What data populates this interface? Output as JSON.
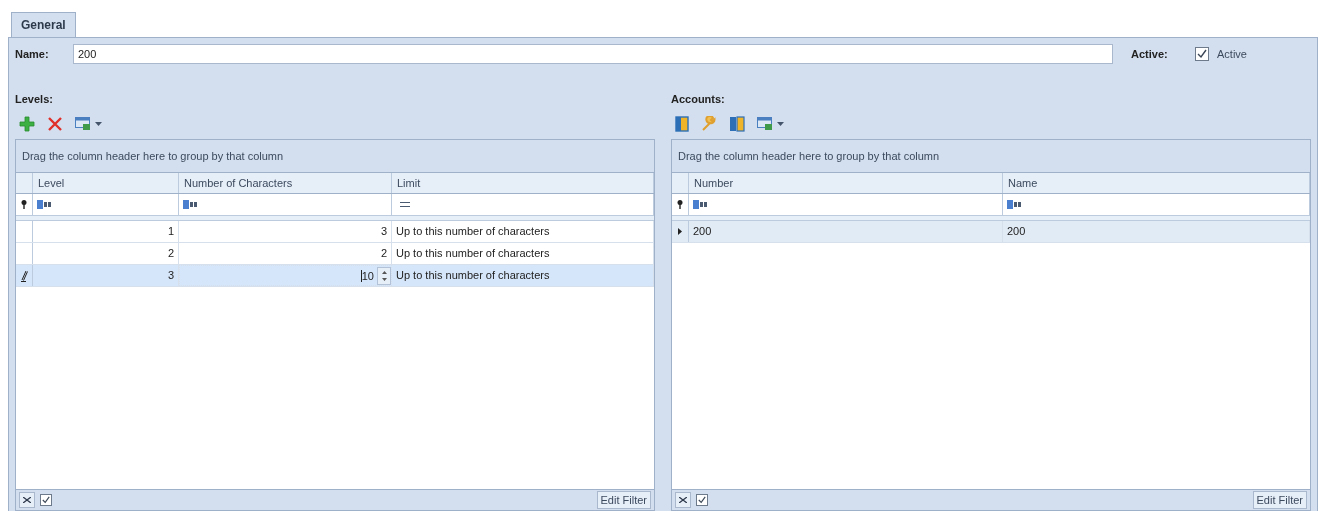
{
  "tabs": [
    {
      "label": "General",
      "selected": true
    }
  ],
  "name_field": {
    "label": "Name:",
    "value": "200"
  },
  "active": {
    "label": "Active:",
    "checkbox_label": "Active",
    "checked": true
  },
  "levels": {
    "title": "Levels:",
    "toolbar": [
      {
        "kind": "add"
      },
      {
        "kind": "delete"
      },
      {
        "kind": "export"
      }
    ],
    "grid": {
      "group_panel": "Drag the column header here to group by that column",
      "columns": [
        "Level",
        "Number of Characters",
        "Limit"
      ],
      "filters": [
        {
          "kind": "text"
        },
        {
          "kind": "text"
        },
        {
          "kind": "equals"
        }
      ],
      "rows": [
        {
          "level": "1",
          "characters": "3",
          "limit": "Up to this number of characters",
          "selected": false,
          "editing": false
        },
        {
          "level": "2",
          "characters": "2",
          "limit": "Up to this number of characters",
          "selected": false,
          "editing": false
        },
        {
          "level": "3",
          "characters": "10",
          "limit": "Up to this number of characters",
          "selected": true,
          "editing": true
        }
      ],
      "footer": {
        "filter_enabled": true,
        "edit_filter": "Edit Filter"
      }
    }
  },
  "accounts": {
    "title": "Accounts:",
    "toolbar": [
      {
        "kind": "door"
      },
      {
        "kind": "wrench"
      },
      {
        "kind": "doors"
      },
      {
        "kind": "export"
      }
    ],
    "grid": {
      "group_panel": "Drag the column header here to group by that column",
      "columns": [
        "Number",
        "Name"
      ],
      "filters": [
        {
          "kind": "text"
        },
        {
          "kind": "text"
        }
      ],
      "rows": [
        {
          "number": "200",
          "name": "200",
          "selected": true
        }
      ],
      "footer": {
        "filter_enabled": true,
        "edit_filter": "Edit Filter"
      }
    }
  }
}
